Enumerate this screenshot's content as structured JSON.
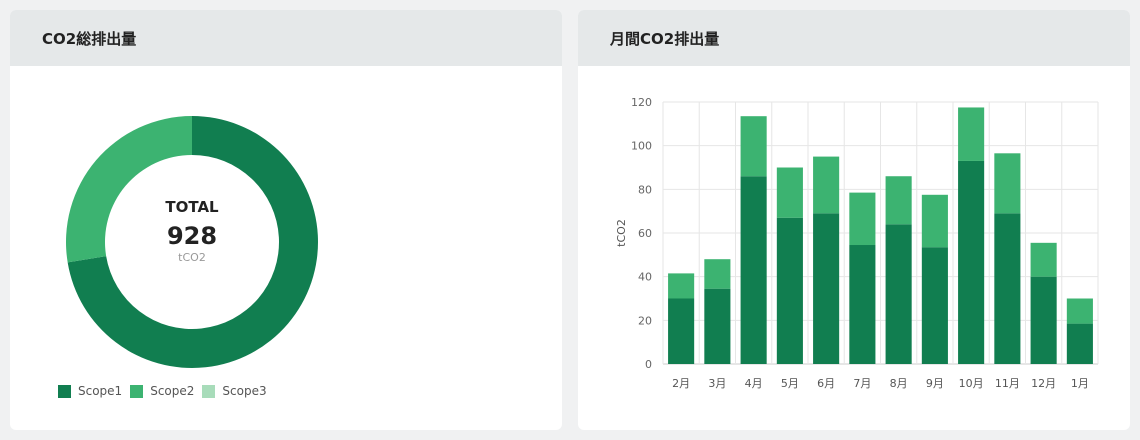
{
  "panels": {
    "left_title": "CO2総排出量",
    "right_title": "月間CO2排出量"
  },
  "donut": {
    "total_label": "TOTAL",
    "total_value": "928",
    "unit": "tCO2",
    "legend": [
      {
        "name": "Scope1",
        "color": "#117e50"
      },
      {
        "name": "Scope2",
        "color": "#3cb371"
      },
      {
        "name": "Scope3",
        "color": "#a8dcba"
      }
    ]
  },
  "chart_data": [
    {
      "type": "pie",
      "labels": [
        "Scope1",
        "Scope2",
        "Scope3"
      ],
      "values": [
        672,
        256,
        0
      ],
      "colors": [
        "#117e50",
        "#3cb371",
        "#a8dcba"
      ],
      "center_text": {
        "label": "TOTAL",
        "value": "928",
        "unit": "tCO2"
      },
      "legend": "bottom-left"
    },
    {
      "type": "bar",
      "stacked": true,
      "categories": [
        "2月",
        "3月",
        "4月",
        "5月",
        "6月",
        "7月",
        "8月",
        "9月",
        "10月",
        "11月",
        "12月",
        "1月"
      ],
      "series": [
        {
          "name": "Scope1",
          "color": "#117e50",
          "values": [
            30,
            34.5,
            86,
            67,
            69,
            54.5,
            64,
            53.5,
            93,
            69,
            40,
            18.5
          ]
        },
        {
          "name": "Scope2",
          "color": "#3cb371",
          "values": [
            11.5,
            13.5,
            27.5,
            23,
            26,
            24,
            22,
            24,
            24.5,
            27.5,
            15.5,
            11.5
          ]
        }
      ],
      "ylabel": "tCO2",
      "ylim": [
        0,
        120
      ],
      "yticks": [
        0,
        20,
        40,
        60,
        80,
        100,
        120
      ],
      "grid": true
    }
  ]
}
